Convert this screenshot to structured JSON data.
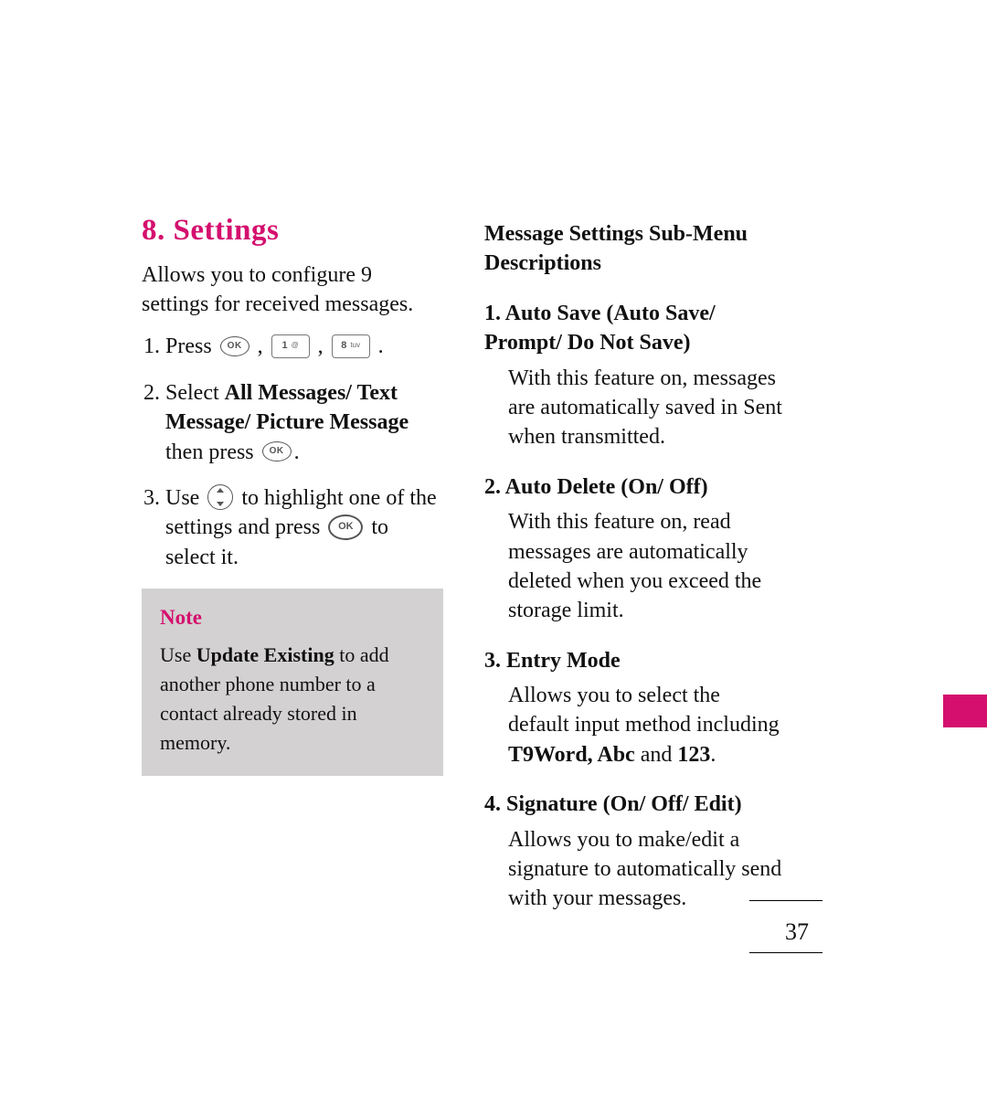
{
  "section": {
    "number": "8.",
    "title": "Settings",
    "intro": "Allows you to configure 9 settings for received messages."
  },
  "steps": {
    "s1_a": "Press",
    "s1_b": ",",
    "s1_c": ",",
    "s1_d": ".",
    "key_ok": "OK",
    "key1_main": "1",
    "key1_sub": "@",
    "key8_main": "8",
    "key8_sub": "tuv",
    "s2_a": "Select ",
    "s2_bold": "All Messages/ Text Message/ Picture Message",
    "s2_b": " then press ",
    "s2_c": ".",
    "s3_a": "Use ",
    "s3_b": " to highlight one of the settings and press ",
    "s3_c": " to select it."
  },
  "note": {
    "title": "Note",
    "a": "Use ",
    "bold": "Update Existing",
    "b": " to add another phone number to a contact already stored in memory."
  },
  "submenu": {
    "heading": "Message Settings Sub-Menu Descriptions",
    "i1_h": "1. Auto Save (Auto Save/ Prompt/ Do Not Save)",
    "i1_b": "With this feature on, messages are automatically saved in Sent when transmitted.",
    "i2_h": "2. Auto Delete (On/ Off)",
    "i2_b": "With this feature on, read messages are automatically deleted when you exceed the storage limit.",
    "i3_h": "3. Entry Mode",
    "i3_a": "Allows you to select the default input method including ",
    "i3_bold1": "T9Word, Abc",
    "i3_mid": " and ",
    "i3_bold2": "123",
    "i3_end": ".",
    "i4_h": "4. Signature (On/ Off/ Edit)",
    "i4_b": "Allows you to make/edit a signature to automatically send with your messages."
  },
  "page_number": "37"
}
